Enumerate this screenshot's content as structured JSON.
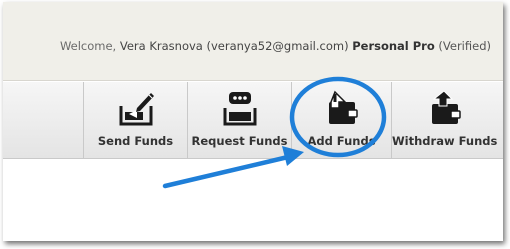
{
  "header": {
    "welcome_prefix": "Welcome,",
    "user_name": "Vera Krasnova",
    "user_email": "(veranya52@gmail.com)",
    "plan": "Personal Pro",
    "status": "(Verified)"
  },
  "toolbar": {
    "buttons": [
      {
        "label": "Send Funds",
        "icon": "send-funds-icon"
      },
      {
        "label": "Request Funds",
        "icon": "request-funds-icon"
      },
      {
        "label": "Add Funds",
        "icon": "add-funds-icon"
      },
      {
        "label": "Withdraw Funds",
        "icon": "withdraw-funds-icon"
      }
    ]
  },
  "annotation": {
    "highlight_color": "#1f7fd8",
    "target": "Add Funds"
  },
  "colors": {
    "header_bg": "#f0efe9",
    "toolbar_bg": "#eeeeee",
    "icon_dark": "#1a1a1a",
    "label_text": "#333333"
  }
}
